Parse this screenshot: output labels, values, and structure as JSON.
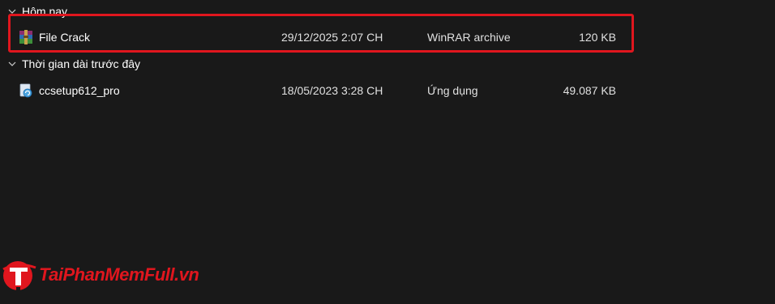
{
  "groups": [
    {
      "label": "Hôm nay",
      "files": [
        {
          "name": "File Crack",
          "date_modified": "29/12/2025 2:07 CH",
          "type": "WinRAR archive",
          "size": "120 KB",
          "icon": "winrar-archive-icon"
        }
      ]
    },
    {
      "label": "Thời gian dài trước đây",
      "files": [
        {
          "name": "ccsetup612_pro",
          "date_modified": "18/05/2023 3:28 CH",
          "type": "Ứng dụng",
          "size": "49.087 KB",
          "icon": "installer-app-icon"
        }
      ]
    }
  ],
  "watermark": {
    "text": "TaiPhanMemFull.vn",
    "color": "#e0161e"
  },
  "colors": {
    "background": "#191919",
    "highlight": "#e0161e"
  }
}
